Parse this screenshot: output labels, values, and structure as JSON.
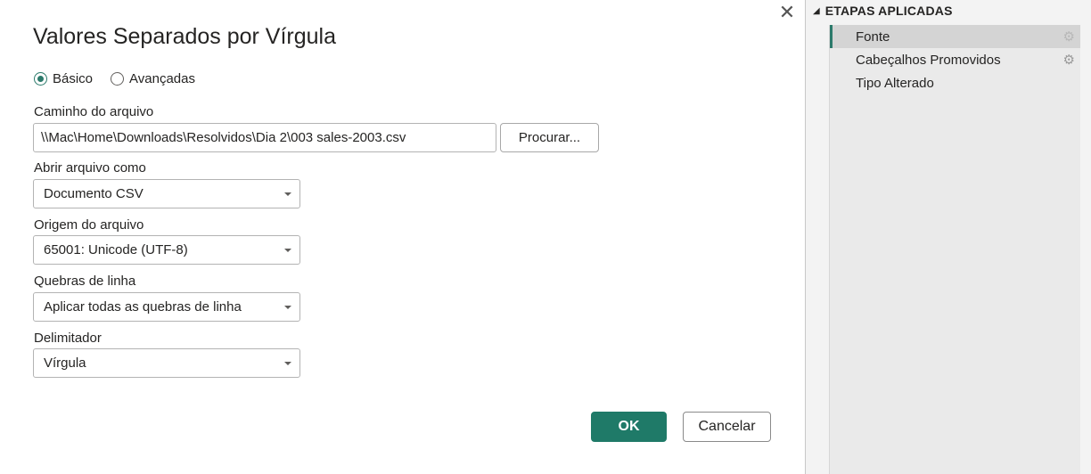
{
  "dialog": {
    "title": "Valores Separados por Vírgula",
    "close_icon": "close-icon",
    "mode_options": [
      {
        "label": "Básico",
        "selected": true
      },
      {
        "label": "Avançadas",
        "selected": false
      }
    ],
    "file_path": {
      "label": "Caminho do arquivo",
      "value": "\\\\Mac\\Home\\Downloads\\Resolvidos\\Dia 2\\003 sales-2003.csv",
      "browse_label": "Procurar..."
    },
    "open_as": {
      "label": "Abrir arquivo como",
      "value": "Documento CSV"
    },
    "file_origin": {
      "label": "Origem do arquivo",
      "value": "65001: Unicode (UTF-8)"
    },
    "line_breaks": {
      "label": "Quebras de linha",
      "value": "Aplicar todas as quebras de linha"
    },
    "delimiter": {
      "label": "Delimitador",
      "value": "Vírgula"
    },
    "ok_label": "OK",
    "cancel_label": "Cancelar"
  },
  "applied_steps": {
    "title": "ETAPAS APLICADAS",
    "steps": [
      {
        "label": "Fonte",
        "has_settings": true,
        "selected": true
      },
      {
        "label": "Cabeçalhos Promovidos",
        "has_settings": true,
        "selected": false
      },
      {
        "label": "Tipo Alterado",
        "has_settings": false,
        "selected": false
      }
    ]
  },
  "colors": {
    "accent": "#1f7a68",
    "selected_step_bg": "#d4d4d4",
    "panel_bg": "#f3f3f3"
  }
}
